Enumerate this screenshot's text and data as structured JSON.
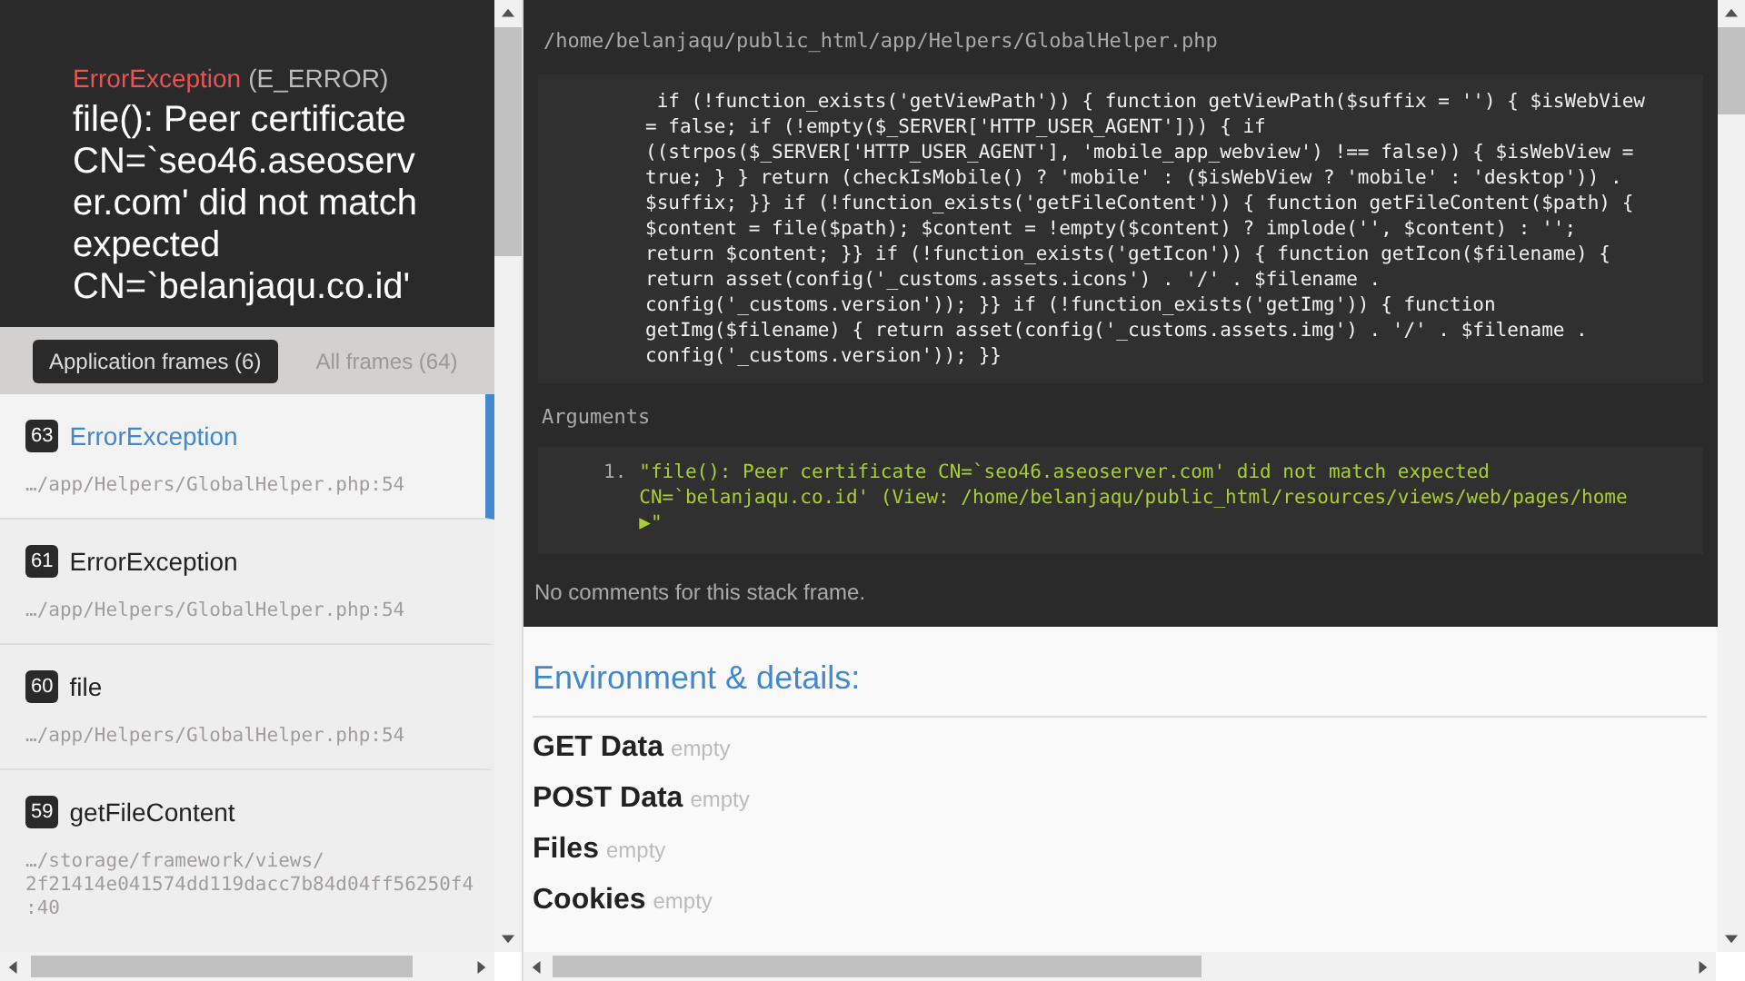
{
  "header": {
    "exception_class": "ErrorException",
    "code": "(E_ERROR)",
    "message": "file(): Peer certificate CN=`seo46.aseoserver.com' did not match expected CN=`belanjaqu.co.id'"
  },
  "frame_tabs": [
    {
      "label": "Application frames (6)",
      "selected": true
    },
    {
      "label": "All frames (64)",
      "selected": false
    }
  ],
  "frames": [
    {
      "index": "63",
      "name": "ErrorException",
      "file_lines": [
        "…/app/Helpers/GlobalHelper.php:54"
      ],
      "selected": true
    },
    {
      "index": "61",
      "name": "ErrorException",
      "file_lines": [
        "…/app/Helpers/GlobalHelper.php:54"
      ],
      "selected": false
    },
    {
      "index": "60",
      "name": "file",
      "file_lines": [
        "…/app/Helpers/GlobalHelper.php:54"
      ],
      "selected": false
    },
    {
      "index": "59",
      "name": "getFileContent",
      "file_lines": [
        "…/storage/framework/views/",
        "2f21414e041574dd119dacc7b84d04ff56250f4",
        ":40"
      ],
      "selected": false
    }
  ],
  "code_panel": {
    "file_path": "/home/belanjaqu/public_html/app/Helpers/GlobalHelper.php",
    "code_lines": [
      " if (!function_exists('getViewPath')) { function getViewPath($suffix = '') { $isWebView",
      "= false; if (!empty($_SERVER['HTTP_USER_AGENT'])) { if",
      "((strpos($_SERVER['HTTP_USER_AGENT'], 'mobile_app_webview') !== false)) { $isWebView =",
      "true; } } return (checkIsMobile() ? 'mobile' : ($isWebView ? 'mobile' : 'desktop')) .",
      "$suffix; }} if (!function_exists('getFileContent')) { function getFileContent($path) {",
      "$content = file($path); $content = !empty($content) ? implode('', $content) : '';",
      "return $content; }} if (!function_exists('getIcon')) { function getIcon($filename) {",
      "return asset(config('_customs.assets.icons') . '/' . $filename .",
      "config('_customs.version')); }} if (!function_exists('getImg')) { function",
      "getImg($filename) { return asset(config('_customs.assets.img') . '/' . $filename .",
      "config('_customs.version')); }}"
    ],
    "arguments_label": "Arguments",
    "arguments": [
      {
        "number": "1.",
        "lines": [
          "\"file(): Peer certificate CN=`seo46.aseoserver.com' did not match expected",
          "CN=`belanjaqu.co.id' (View: /home/belanjaqu/public_html/resources/views/web/pages/home",
          "▶\""
        ]
      }
    ],
    "comments": "No comments for this stack frame."
  },
  "details": {
    "title": "Environment & details:",
    "sections": [
      {
        "name": "GET Data",
        "value": "empty"
      },
      {
        "name": "POST Data",
        "value": "empty"
      },
      {
        "name": "Files",
        "value": "empty"
      },
      {
        "name": "Cookies",
        "value": "empty"
      }
    ]
  }
}
